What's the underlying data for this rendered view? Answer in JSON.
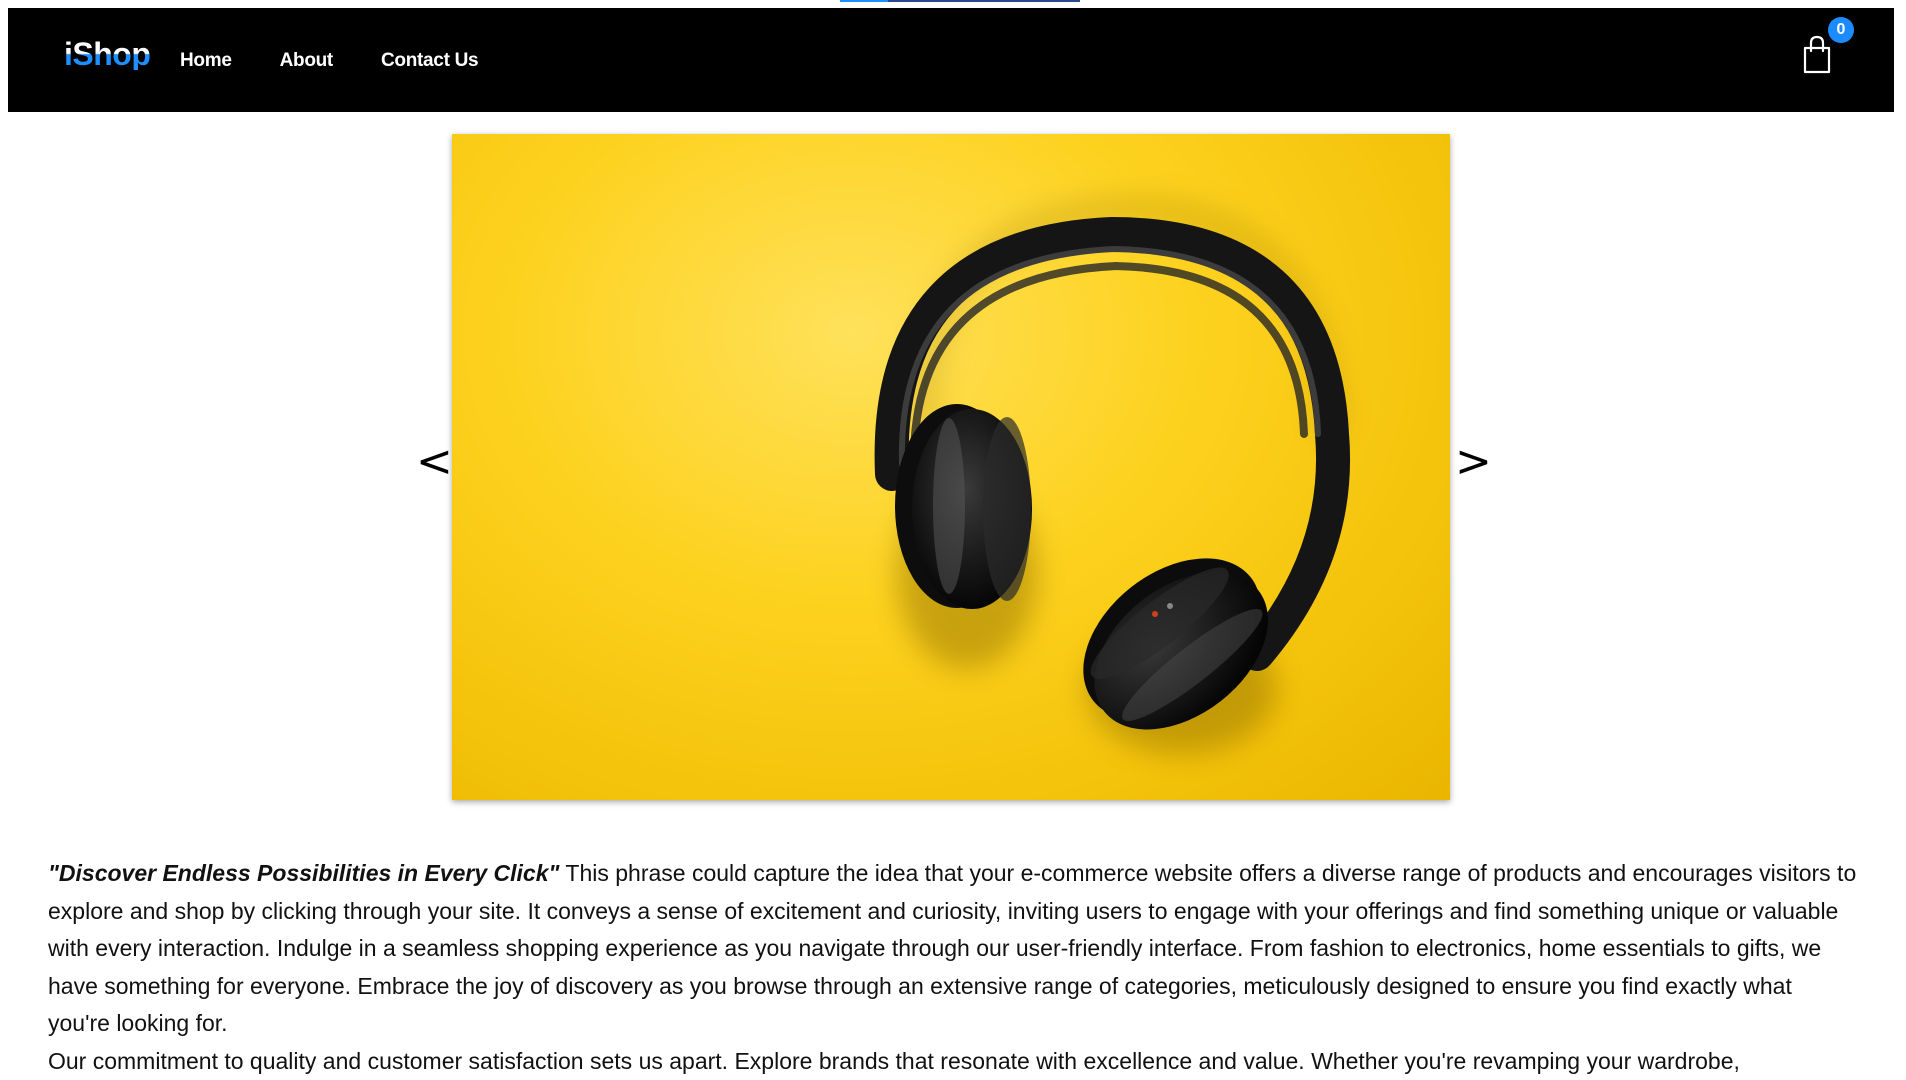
{
  "navbar": {
    "brand": "iShop",
    "links": [
      {
        "label": "Home"
      },
      {
        "label": "About"
      },
      {
        "label": "Contact Us"
      }
    ],
    "cart": {
      "icon": "shopping-bag-icon",
      "count": "0"
    },
    "colors": {
      "background": "#000000",
      "brand": "#1e8fff",
      "badge": "#1a8cff"
    }
  },
  "carousel": {
    "prev_label": "<",
    "next_label": ">",
    "slide": {
      "subject": "headphones",
      "background": "#fdd21f"
    }
  },
  "content": {
    "tagline": "\"Discover Endless Possibilities in Every Click\"",
    "paragraph1": " This phrase could capture the idea that your e-commerce website offers a diverse range of products and encourages visitors to explore and shop by clicking through your site. It conveys a sense of excitement and curiosity, inviting users to engage with your offerings and find something unique or valuable with every interaction. Indulge in a seamless shopping experience as you navigate through our user-friendly interface. From fashion to electronics, home essentials to gifts, we have something for everyone. Embrace the joy of discovery as you browse through an extensive range of categories, meticulously designed to ensure you find exactly what you're looking for.",
    "paragraph2": "Our commitment to quality and customer satisfaction sets us apart. Explore brands that resonate with excellence and value. Whether you're revamping your wardrobe,"
  }
}
